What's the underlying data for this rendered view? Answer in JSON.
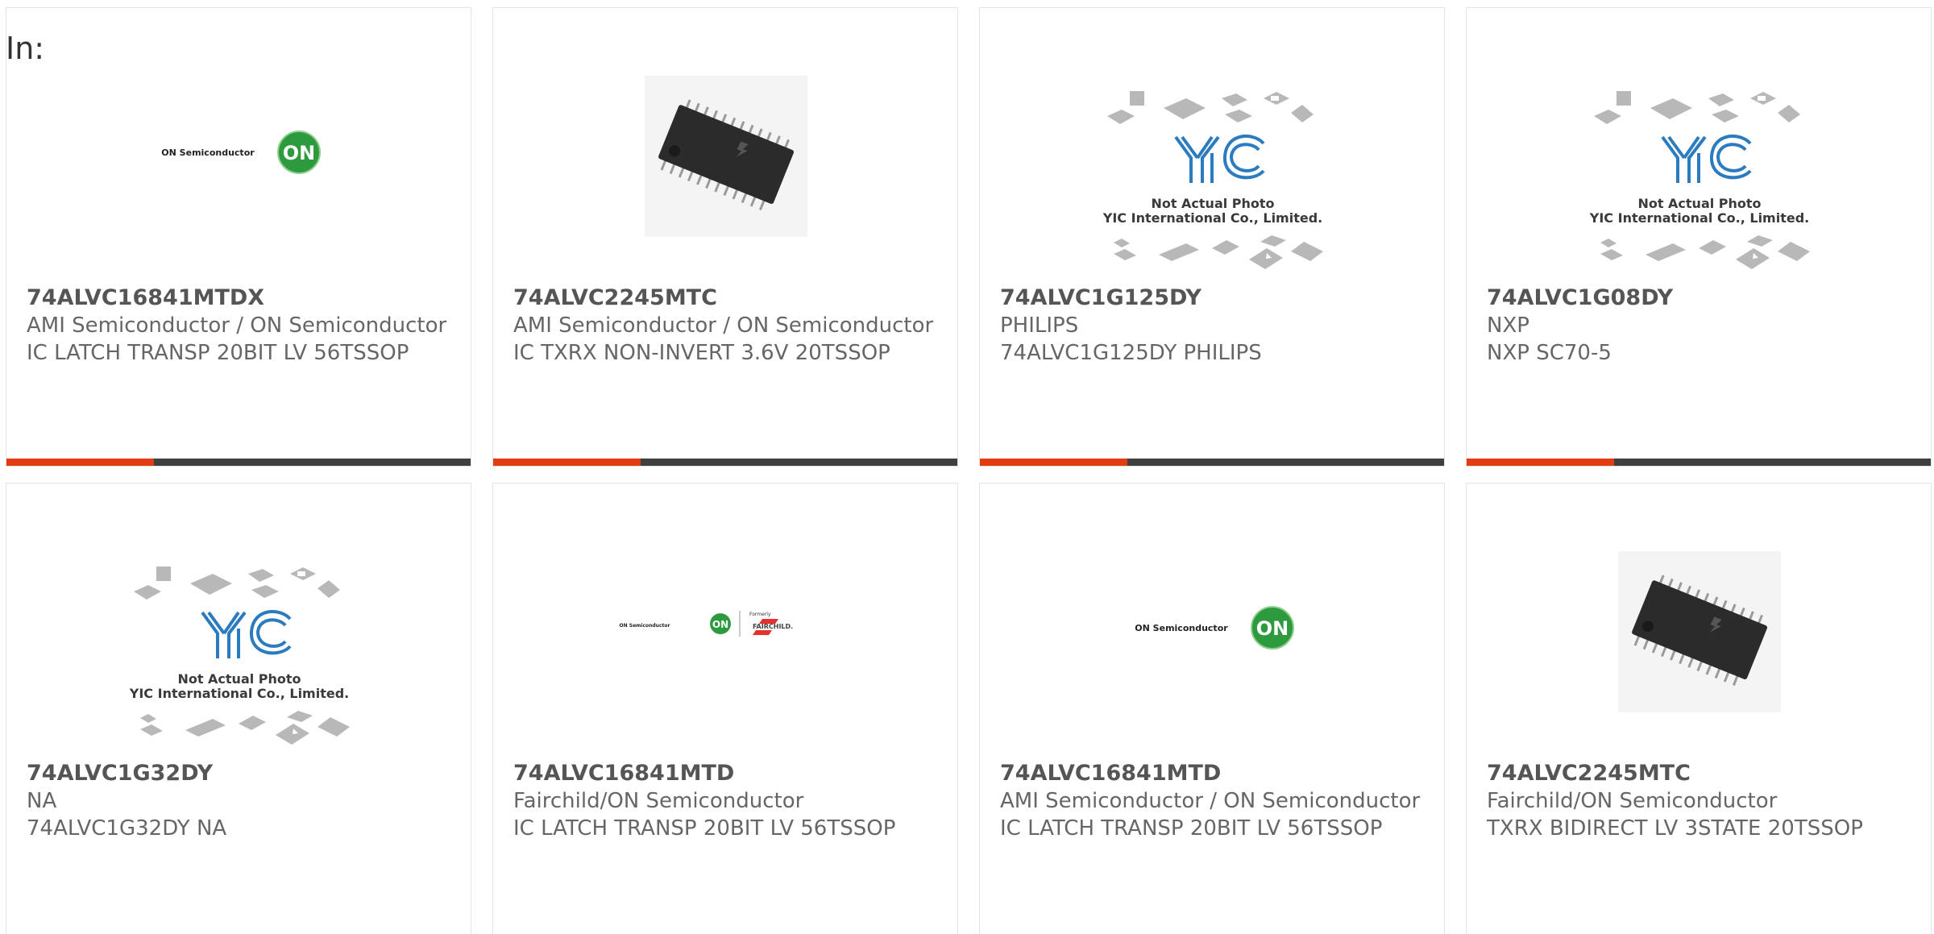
{
  "filter_label": "In:",
  "colors": {
    "accent": "#e33c12",
    "bar": "#3f3f3f",
    "yic_blue": "#2a7bbf"
  },
  "products": [
    {
      "part": "74ALVC16841MTDX",
      "manufacturer": "AMI Semiconductor / ON Semiconductor",
      "description": "IC LATCH TRANSP 20BIT LV 56TSSOP",
      "image": "on-semiconductor-logo",
      "logo_text": "ON Semiconductor",
      "logo_mark": "ON"
    },
    {
      "part": "74ALVC2245MTC",
      "manufacturer": "AMI Semiconductor / ON Semiconductor",
      "description": "IC TXRX NON-INVERT 3.6V 20TSSOP",
      "image": "tssop-chip-photo"
    },
    {
      "part": "74ALVC1G125DY",
      "manufacturer": "PHILIPS",
      "description": "74ALVC1G125DY PHILIPS",
      "image": "yic-not-actual-photo",
      "yic_line1": "Not Actual Photo",
      "yic_line2": "YIC International Co., Limited."
    },
    {
      "part": "74ALVC1G08DY",
      "manufacturer": "NXP",
      "description": "NXP SC70-5",
      "image": "yic-not-actual-photo",
      "yic_line1": "Not Actual Photo",
      "yic_line2": "YIC International Co., Limited."
    },
    {
      "part": "74ALVC1G32DY",
      "manufacturer": "NA",
      "description": "74ALVC1G32DY NA",
      "image": "yic-not-actual-photo",
      "yic_line1": "Not Actual Photo",
      "yic_line2": "YIC International Co., Limited."
    },
    {
      "part": "74ALVC16841MTD",
      "manufacturer": "Fairchild/ON Semiconductor",
      "description": "IC LATCH TRANSP 20BIT LV 56TSSOP",
      "image": "on-fairchild-logo",
      "logo_text": "ON Semiconductor",
      "logo_mark": "ON",
      "formerly": "Formerly",
      "fairchild": "FAIRCHILD."
    },
    {
      "part": "74ALVC16841MTD",
      "manufacturer": "AMI Semiconductor / ON Semiconductor",
      "description": "IC LATCH TRANSP 20BIT LV 56TSSOP",
      "image": "on-semiconductor-logo",
      "logo_text": "ON Semiconductor",
      "logo_mark": "ON"
    },
    {
      "part": "74ALVC2245MTC",
      "manufacturer": "Fairchild/ON Semiconductor",
      "description": "TXRX BIDIRECT LV 3STATE 20TSSOP",
      "image": "tssop-chip-photo"
    }
  ]
}
